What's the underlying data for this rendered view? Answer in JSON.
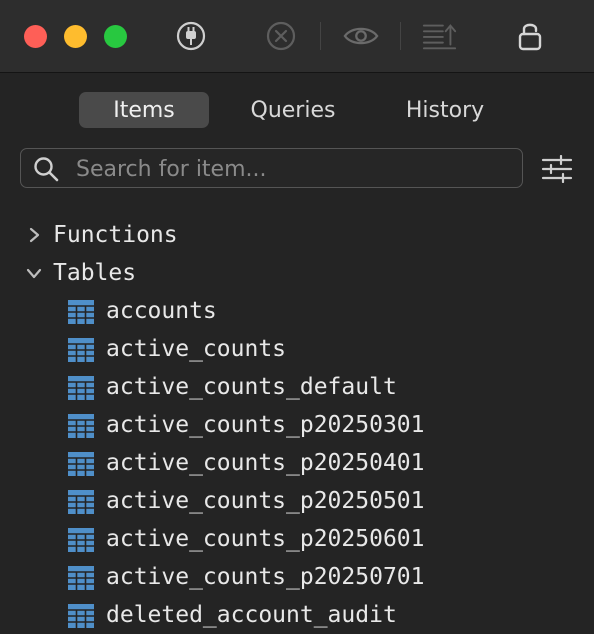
{
  "toolbar": {
    "icons": [
      "connect-plug-icon",
      "cancel-icon",
      "preview-eye-icon",
      "sort-list-icon",
      "lock-icon"
    ]
  },
  "tabs": [
    {
      "label": "Items",
      "active": true
    },
    {
      "label": "Queries",
      "active": false
    },
    {
      "label": "History",
      "active": false
    }
  ],
  "search": {
    "placeholder": "Search for item...",
    "value": ""
  },
  "tree": {
    "groups": [
      {
        "label": "Functions",
        "expanded": false
      },
      {
        "label": "Tables",
        "expanded": true
      }
    ],
    "tables": [
      "accounts",
      "active_counts",
      "active_counts_default",
      "active_counts_p20250301",
      "active_counts_p20250401",
      "active_counts_p20250501",
      "active_counts_p20250601",
      "active_counts_p20250701",
      "deleted_account_audit"
    ]
  },
  "colors": {
    "accent_table_icon": "#4f8fc9",
    "active_tab_bg": "#4a4a4a",
    "traffic_red": "#fe5f57",
    "traffic_yellow": "#febc2e",
    "traffic_green": "#28c840"
  }
}
